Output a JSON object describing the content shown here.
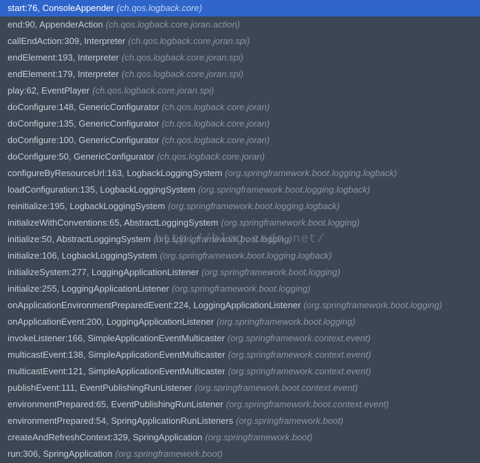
{
  "watermark": "http://blog.csdn.net/",
  "frames": [
    {
      "method": "start:76, ConsoleAppender",
      "pkg": "(ch.qos.logback.core)",
      "selected": true
    },
    {
      "method": "end:90, AppenderAction",
      "pkg": "(ch.qos.logback.core.joran.action)",
      "selected": false
    },
    {
      "method": "callEndAction:309, Interpreter",
      "pkg": "(ch.qos.logback.core.joran.spi)",
      "selected": false
    },
    {
      "method": "endElement:193, Interpreter",
      "pkg": "(ch.qos.logback.core.joran.spi)",
      "selected": false
    },
    {
      "method": "endElement:179, Interpreter",
      "pkg": "(ch.qos.logback.core.joran.spi)",
      "selected": false
    },
    {
      "method": "play:62, EventPlayer",
      "pkg": "(ch.qos.logback.core.joran.spi)",
      "selected": false
    },
    {
      "method": "doConfigure:148, GenericConfigurator",
      "pkg": "(ch.qos.logback.core.joran)",
      "selected": false
    },
    {
      "method": "doConfigure:135, GenericConfigurator",
      "pkg": "(ch.qos.logback.core.joran)",
      "selected": false
    },
    {
      "method": "doConfigure:100, GenericConfigurator",
      "pkg": "(ch.qos.logback.core.joran)",
      "selected": false
    },
    {
      "method": "doConfigure:50, GenericConfigurator",
      "pkg": "(ch.qos.logback.core.joran)",
      "selected": false
    },
    {
      "method": "configureByResourceUrl:163, LogbackLoggingSystem",
      "pkg": "(org.springframework.boot.logging.logback)",
      "selected": false
    },
    {
      "method": "loadConfiguration:135, LogbackLoggingSystem",
      "pkg": "(org.springframework.boot.logging.logback)",
      "selected": false
    },
    {
      "method": "reinitialize:195, LogbackLoggingSystem",
      "pkg": "(org.springframework.boot.logging.logback)",
      "selected": false
    },
    {
      "method": "initializeWithConventions:65, AbstractLoggingSystem",
      "pkg": "(org.springframework.boot.logging)",
      "selected": false
    },
    {
      "method": "initialize:50, AbstractLoggingSystem",
      "pkg": "(org.springframework.boot.logging)",
      "selected": false
    },
    {
      "method": "initialize:106, LogbackLoggingSystem",
      "pkg": "(org.springframework.boot.logging.logback)",
      "selected": false
    },
    {
      "method": "initializeSystem:277, LoggingApplicationListener",
      "pkg": "(org.springframework.boot.logging)",
      "selected": false
    },
    {
      "method": "initialize:255, LoggingApplicationListener",
      "pkg": "(org.springframework.boot.logging)",
      "selected": false
    },
    {
      "method": "onApplicationEnvironmentPreparedEvent:224, LoggingApplicationListener",
      "pkg": "(org.springframework.boot.logging)",
      "selected": false
    },
    {
      "method": "onApplicationEvent:200, LoggingApplicationListener",
      "pkg": "(org.springframework.boot.logging)",
      "selected": false
    },
    {
      "method": "invokeListener:166, SimpleApplicationEventMulticaster",
      "pkg": "(org.springframework.context.event)",
      "selected": false
    },
    {
      "method": "multicastEvent:138, SimpleApplicationEventMulticaster",
      "pkg": "(org.springframework.context.event)",
      "selected": false
    },
    {
      "method": "multicastEvent:121, SimpleApplicationEventMulticaster",
      "pkg": "(org.springframework.context.event)",
      "selected": false
    },
    {
      "method": "publishEvent:111, EventPublishingRunListener",
      "pkg": "(org.springframework.boot.context.event)",
      "selected": false
    },
    {
      "method": "environmentPrepared:65, EventPublishingRunListener",
      "pkg": "(org.springframework.boot.context.event)",
      "selected": false
    },
    {
      "method": "environmentPrepared:54, SpringApplicationRunListeners",
      "pkg": "(org.springframework.boot)",
      "selected": false
    },
    {
      "method": "createAndRefreshContext:329, SpringApplication",
      "pkg": "(org.springframework.boot)",
      "selected": false
    },
    {
      "method": "run:306, SpringApplication",
      "pkg": "(org.springframework.boot)",
      "selected": false
    }
  ]
}
